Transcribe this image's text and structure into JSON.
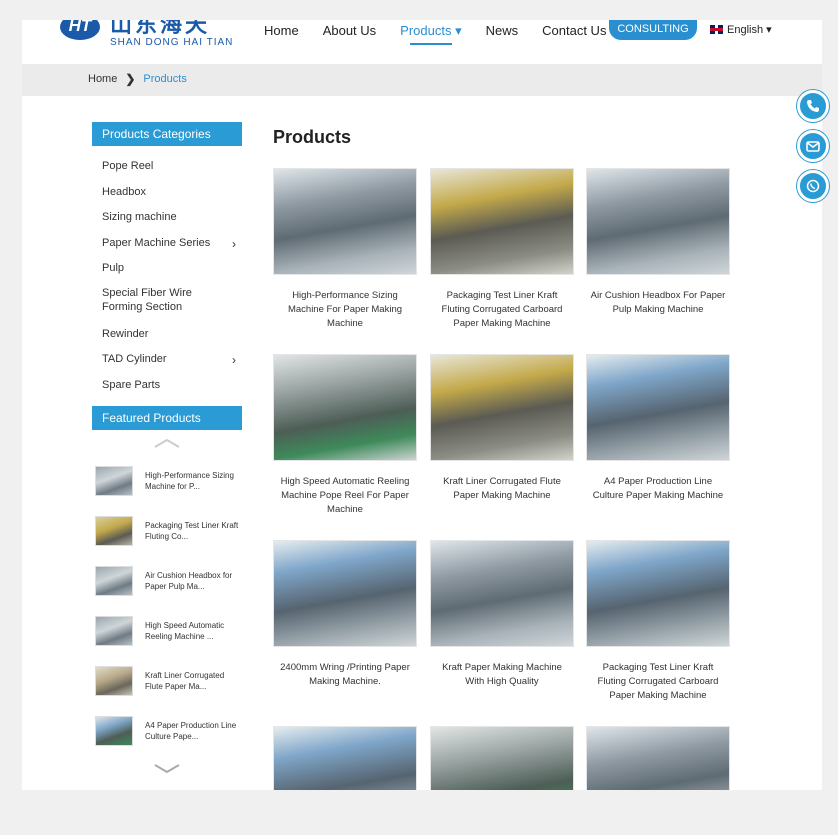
{
  "header": {
    "logo_cn": "山东海天",
    "logo_en": "SHAN DONG HAI TIAN",
    "logo_mark": "HT",
    "nav": [
      {
        "label": "Home"
      },
      {
        "label": "About Us"
      },
      {
        "label": "Products ▾"
      },
      {
        "label": "News"
      },
      {
        "label": "Contact Us"
      }
    ],
    "consulting": "CONSULTING",
    "language": "English ▾"
  },
  "breadcrumb": {
    "home": "Home",
    "sep": "❯",
    "current": "Products"
  },
  "sidebar": {
    "categories_title": "Products Categories",
    "categories": [
      {
        "label": "Pope Reel"
      },
      {
        "label": "Headbox"
      },
      {
        "label": "Sizing machine"
      },
      {
        "label": "Paper Machine Series"
      },
      {
        "label": "Pulp"
      },
      {
        "label": "Special Fiber Wire Forming Section"
      },
      {
        "label": "Rewinder"
      },
      {
        "label": "TAD Cylinder"
      },
      {
        "label": "Spare Parts"
      }
    ],
    "featured_title": "Featured Products",
    "featured": [
      {
        "label": "High-Performance Sizing Machine for P..."
      },
      {
        "label": "Packaging Test Liner Kraft Fluting Co..."
      },
      {
        "label": "Air Cushion Headbox for Paper Pulp Ma..."
      },
      {
        "label": "High Speed Automatic Reeling Machine ..."
      },
      {
        "label": "Kraft Liner Corrugated Flute Paper Ma..."
      },
      {
        "label": "A4 Paper Production Line Culture Pape..."
      }
    ]
  },
  "main": {
    "title": "Products",
    "products": [
      {
        "label": "High-Performance Sizing Machine For Paper Making Machine"
      },
      {
        "label": "Packaging Test Liner Kraft Fluting Corrugated Carboard Paper Making Machine"
      },
      {
        "label": "Air Cushion Headbox For Paper Pulp Making Machine"
      },
      {
        "label": "High Speed Automatic Reeling Machine Pope Reel For Paper Machine"
      },
      {
        "label": "Kraft Liner Corrugated Flute Paper Making Machine"
      },
      {
        "label": "A4 Paper Production Line Culture Paper Making Machine"
      },
      {
        "label": "2400mm Wring /Printing Paper Making Machine."
      },
      {
        "label": "Kraft Paper Making Machine With High Quality"
      },
      {
        "label": "Packaging Test Liner Kraft Fluting Corrugated Carboard Paper Making Machine"
      }
    ]
  },
  "colors": {
    "accent": "#2a8fd1",
    "header_blue": "#2a9bd4",
    "logo_blue": "#1a5aa8"
  }
}
